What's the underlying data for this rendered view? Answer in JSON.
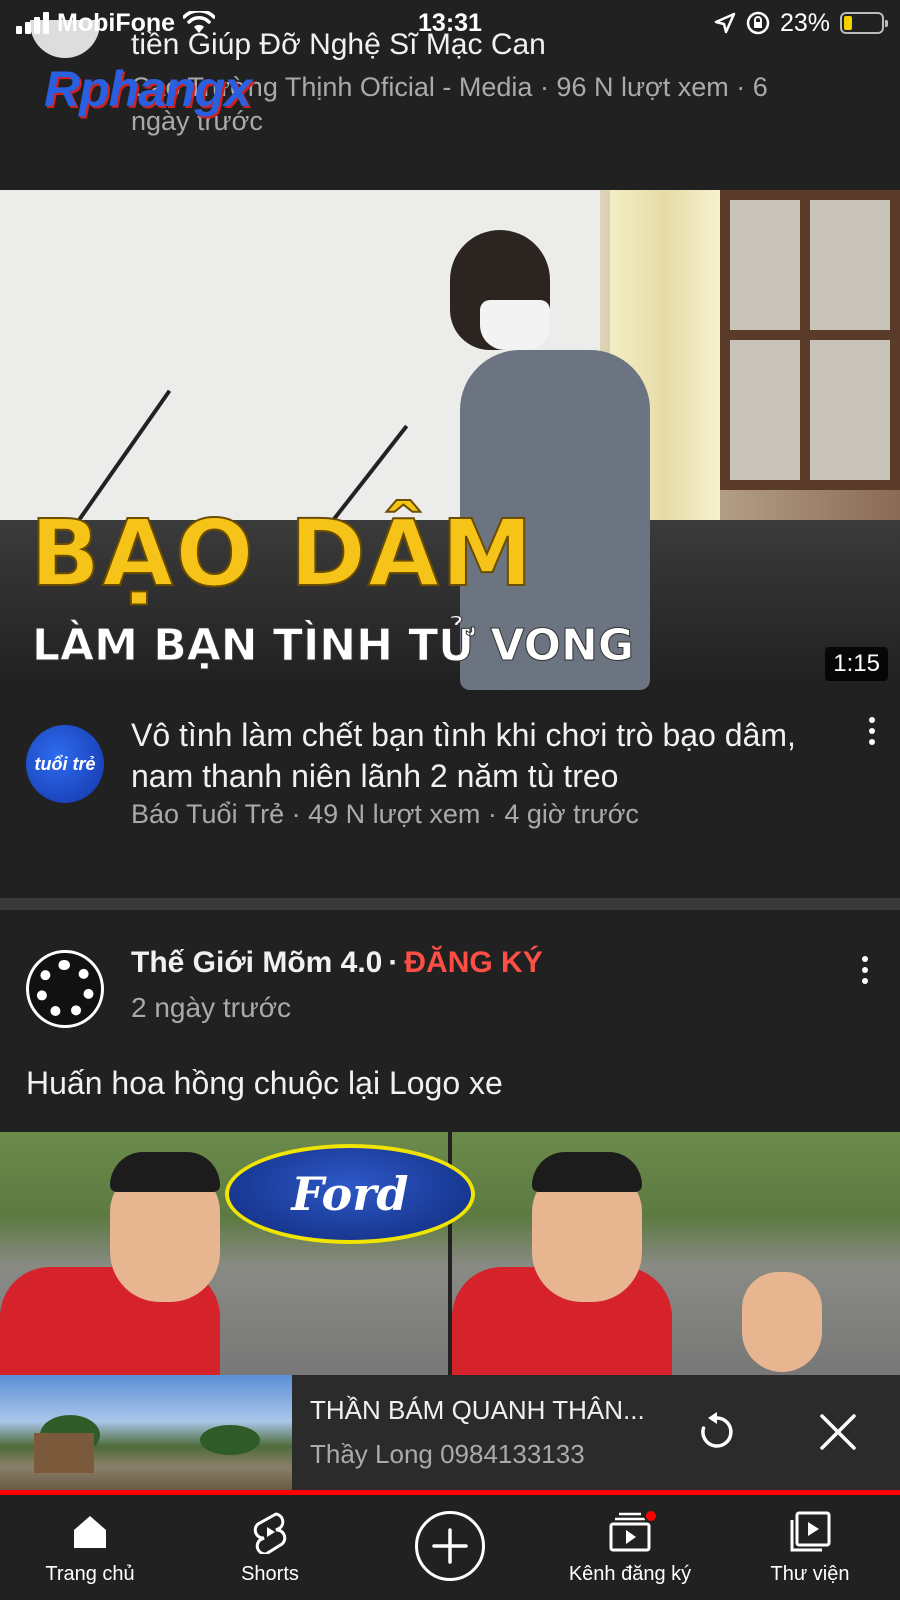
{
  "status_bar": {
    "carrier": "MobiFone",
    "time": "13:31",
    "battery_percent": "23%",
    "battery_level": 0.23
  },
  "previous_video": {
    "title_fragment": "tiền Giúp Đỡ Nghệ Sĩ Mạc Can",
    "meta": "Cao Trường Thịnh Oficial - Media · 96 N lượt xem · 6 ngày trước"
  },
  "watermark": "Rphangx",
  "main_video": {
    "thumbnail_headline": "BẠO DÂM",
    "thumbnail_subline": "LÀM BẠN TÌNH TỬ VONG",
    "duration": "1:15",
    "channel_avatar_text": "tuổi trẻ",
    "title": "Vô tình làm chết bạn tình khi chơi trò bạo dâm, nam thanh niên lãnh 2 năm tù treo",
    "meta": "Báo Tuổi Trẻ · 49 N lượt xem · 4 giờ trước"
  },
  "community_post": {
    "channel_name": "Thế Giới Mõm 4.0",
    "separator": "·",
    "subscribe_label": "ĐĂNG KÝ",
    "time": "2 ngày trước",
    "text": "Huấn hoa hồng chuộc lại Logo xe",
    "image_logo_text": "Ford"
  },
  "mini_player": {
    "title": "THẦN BÁM QUANH THÂN...",
    "channel": "Thầy Long 0984133133",
    "progress": 1.0
  },
  "bottom_nav": {
    "items": [
      {
        "label": "Trang chủ",
        "icon": "home-icon"
      },
      {
        "label": "Shorts",
        "icon": "shorts-icon"
      },
      {
        "label": "",
        "icon": "create-icon"
      },
      {
        "label": "Kênh đăng ký",
        "icon": "subscriptions-icon"
      },
      {
        "label": "Thư viện",
        "icon": "library-icon"
      }
    ]
  },
  "colors": {
    "background": "#212121",
    "subscribe_red": "#ff4e45",
    "progress_red": "#ff0000",
    "thumbnail_headline_yellow": "#f6c419"
  }
}
